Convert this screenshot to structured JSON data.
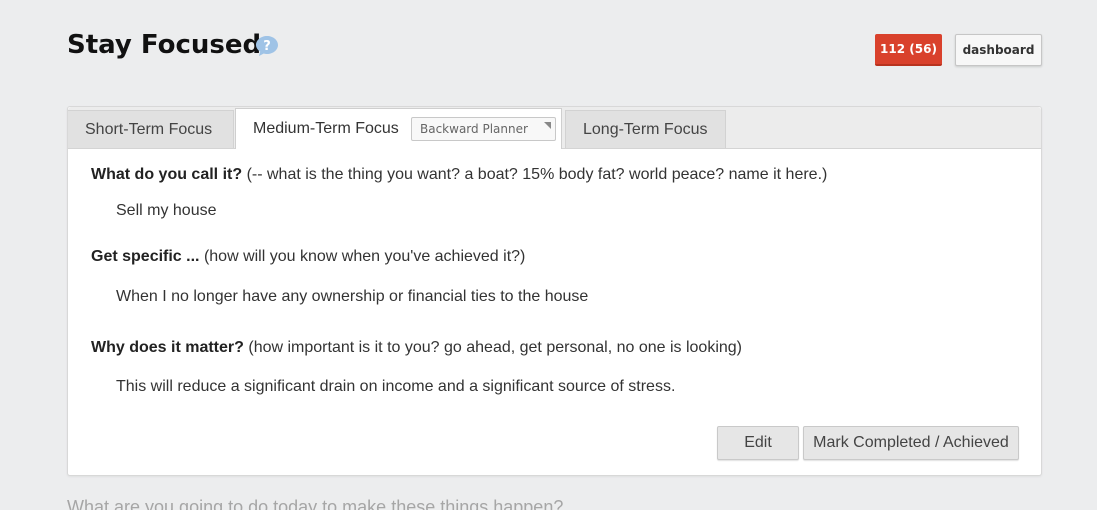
{
  "header": {
    "title": "Stay Focused",
    "badge_count": "112 (56)",
    "dashboard_label": "dashboard",
    "help_icon": "question-bubble-icon",
    "badge_color": "#d9412c"
  },
  "tabs": [
    {
      "label": "Short-Term Focus",
      "active": false
    },
    {
      "label": "Medium-Term Focus",
      "active": true
    },
    {
      "label": "Long-Term Focus",
      "active": false
    }
  ],
  "planner_select": {
    "value": "Backward Planner"
  },
  "questions": [
    {
      "title": "What do you call it?",
      "hint": "(-- what is the thing you want? a boat? 15% body fat? world peace? name it here.)",
      "answer": "Sell my house"
    },
    {
      "title": "Get specific ...",
      "hint": "(how will you know when you've achieved it?)",
      "answer": "When I no longer have any ownership or financial ties to the house"
    },
    {
      "title": "Why does it matter?",
      "hint": "(how important is it to you? go ahead, get personal, no one is looking)",
      "answer": "This will reduce a significant drain on income and a significant source of stress."
    }
  ],
  "actions": {
    "edit_label": "Edit",
    "complete_label": "Mark Completed / Achieved"
  },
  "footer": {
    "prompt": "What are you going to do today to make these things happen?"
  }
}
